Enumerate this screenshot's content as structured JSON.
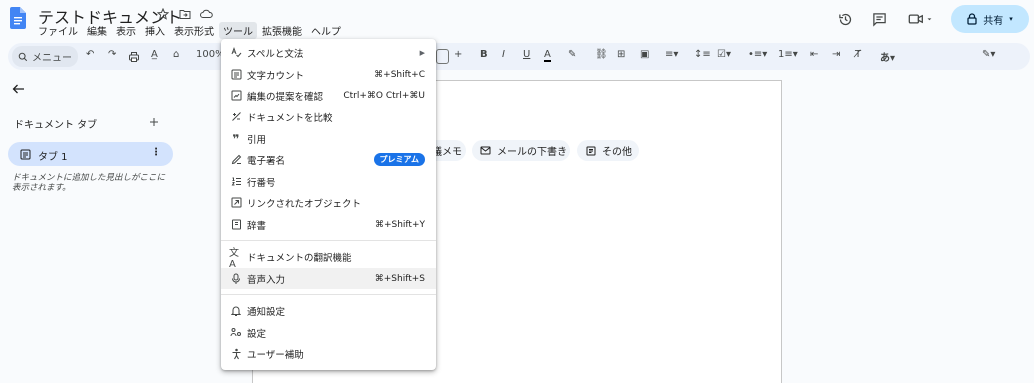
{
  "doc": {
    "title": "テストドキュメント"
  },
  "menubar": [
    "ファイル",
    "編集",
    "表示",
    "挿入",
    "表示形式",
    "ツール",
    "拡張機能",
    "ヘルプ"
  ],
  "header": {
    "share_label": "共有"
  },
  "toolbar": {
    "search_placeholder": "メニュー",
    "zoom": "100%"
  },
  "sidebar": {
    "title": "ドキュメント タブ",
    "tab_label": "タブ 1",
    "note": "ドキュメントに追加した見出しがここに表示されます。"
  },
  "chips": {
    "memo": "議メモ",
    "email": "メールの下書き",
    "more": "その他"
  },
  "tools_menu": {
    "spelling": "スペルと文法",
    "word_count": "文字カウント",
    "word_count_shortcut": "⌘+Shift+C",
    "review_suggestions": "編集の提案を確認",
    "review_suggestions_shortcut": "Ctrl+⌘O Ctrl+⌘U",
    "compare": "ドキュメントを比較",
    "citations": "引用",
    "esignature": "電子署名",
    "esignature_badge": "プレミアム",
    "line_numbers": "行番号",
    "linked_objects": "リンクされたオブジェクト",
    "dictionary": "辞書",
    "dictionary_shortcut": "⌘+Shift+Y",
    "translate": "ドキュメントの翻訳機能",
    "voice_typing": "音声入力",
    "voice_typing_shortcut": "⌘+Shift+S",
    "notifications": "通知設定",
    "preferences": "設定",
    "accessibility": "ユーザー補助"
  },
  "colors": {
    "accent": "#1a73e8",
    "share_bg": "#c2e7ff",
    "tab_bg": "#d3e3fd",
    "docs_blue": "#4285f4"
  }
}
